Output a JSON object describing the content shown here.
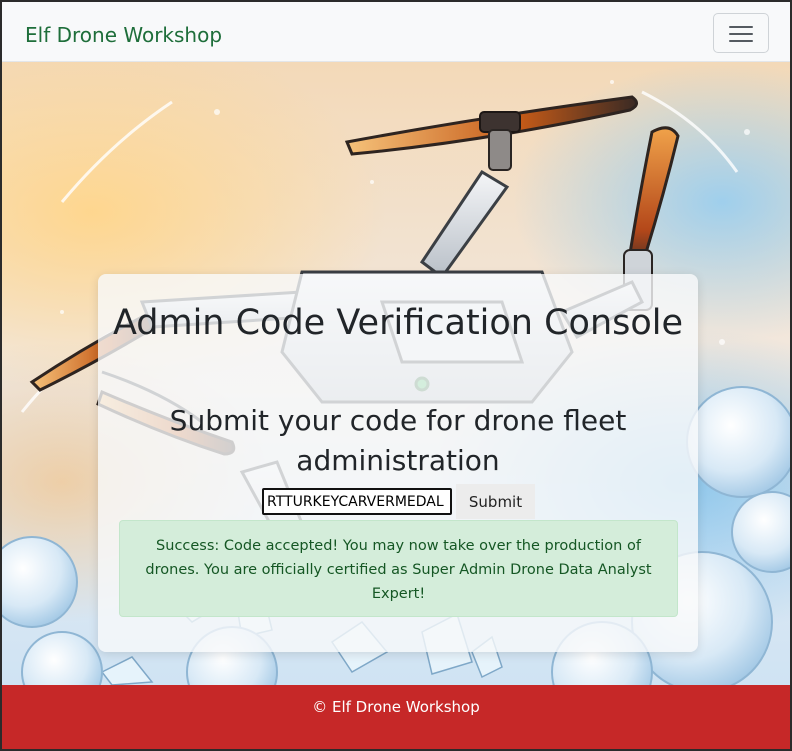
{
  "navbar": {
    "brand": "Elf Drone Workshop",
    "toggler_icon": "hamburger-icon"
  },
  "hero": {
    "background_image": "drone-illustration"
  },
  "card": {
    "title": "Admin Code Verification Console",
    "subtitle": "Submit your code for drone fleet administration",
    "code_input_value": "RTTURKEYCARVERMEDAL",
    "submit_label": "Submit",
    "alert_text": "Success: Code accepted! You may now take over the production of drones. You are officially certified as Super Admin Drone Data Analyst Expert!"
  },
  "footer": {
    "text": "© Elf Drone Workshop"
  },
  "colors": {
    "brand_text": "#1e6e3a",
    "footer_bg": "#c62828",
    "alert_bg": "#d4edda",
    "alert_text": "#155724"
  }
}
